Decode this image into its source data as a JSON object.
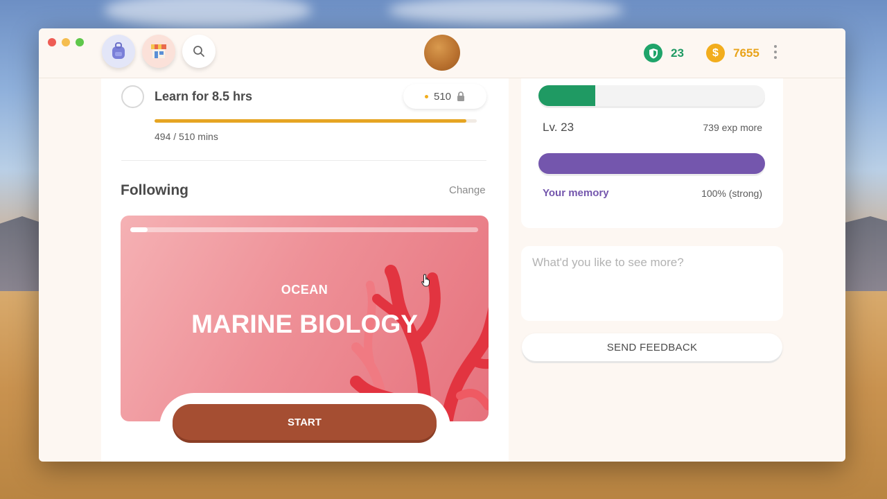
{
  "header": {
    "backpack_icon": "backpack-icon",
    "shop_icon": "shop-icon",
    "search_icon": "search-icon",
    "shield_count": "23",
    "coin_count": "7655",
    "coin_symbol": "$"
  },
  "goal": {
    "title": "Learn for 8.5 hrs",
    "reward": "510",
    "progress_text": "494 / 510 mins",
    "progress_fraction": 0.9686
  },
  "following": {
    "title": "Following",
    "change_label": "Change"
  },
  "course": {
    "category": "OCEAN",
    "title": "MARINE BIOLOGY",
    "start_label": "START",
    "progress_fraction": 0.05
  },
  "stats": {
    "level_label": "Lv. 23",
    "exp_label": "739 exp more",
    "level_fraction": 0.25,
    "memory_label": "Your memory",
    "memory_value": "100% (strong)",
    "memory_fraction": 1.0
  },
  "feedback": {
    "placeholder": "What'd you like to see more?",
    "send_label": "SEND FEEDBACK"
  },
  "colors": {
    "level": "#1f9a63",
    "memory": "#7456ad",
    "start": "#a54e32",
    "coin": "#e8a31a",
    "goal_bar": "#e6a522"
  }
}
